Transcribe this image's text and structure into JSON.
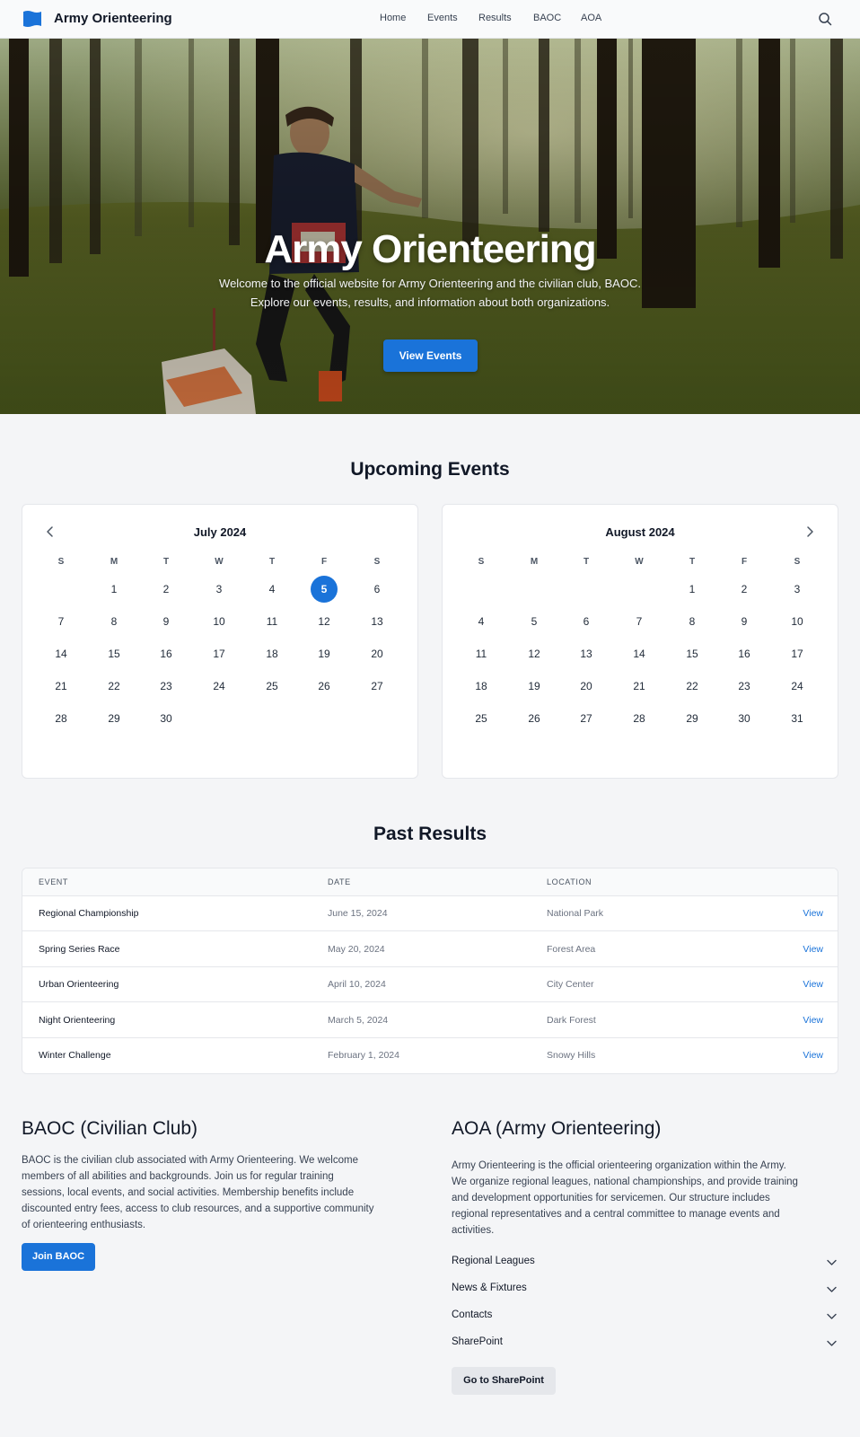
{
  "nav": {
    "brand": "Army Orienteering",
    "links": [
      "Home",
      "Events",
      "Results",
      "BAOC",
      "AOA"
    ],
    "search_icon": "search-icon",
    "logo_icon": "flag-icon",
    "brand_color": "#1a73d9"
  },
  "hero": {
    "title": "Army Orienteering",
    "subtitle_line1": "Welcome to the official website for Army Orienteering and the civilian club, BAOC.",
    "subtitle_line2": "Explore our events, results, and information about both organizations.",
    "button_label": "View Events"
  },
  "events": {
    "title": "Upcoming Events",
    "weekdays": [
      "S",
      "M",
      "T",
      "W",
      "T",
      "F",
      "S"
    ],
    "calendars": [
      {
        "month": "July 2024",
        "first_weekday": 1,
        "days": 30,
        "selected": 5
      },
      {
        "month": "August 2024",
        "first_weekday": 4,
        "days": 31,
        "selected": null
      }
    ],
    "prev_icon": "chevron-left-icon",
    "next_icon": "chevron-right-icon"
  },
  "results": {
    "title": "Past Results",
    "headers": {
      "event": "EVENT",
      "date": "DATE",
      "location": "LOCATION"
    },
    "rows": [
      {
        "event": "Regional Championship",
        "date": "June 15, 2024",
        "location": "National Park",
        "action": "View"
      },
      {
        "event": "Spring Series Race",
        "date": "May 20, 2024",
        "location": "Forest Area",
        "action": "View"
      },
      {
        "event": "Urban Orienteering",
        "date": "April 10, 2024",
        "location": "City Center",
        "action": "View"
      },
      {
        "event": "Night Orienteering",
        "date": "March 5, 2024",
        "location": "Dark Forest",
        "action": "View"
      },
      {
        "event": "Winter Challenge",
        "date": "February 1, 2024",
        "location": "Snowy Hills",
        "action": "View"
      }
    ]
  },
  "baoc": {
    "title": "BAOC (Civilian Club)",
    "lines": [
      "BAOC is the civilian club associated with Army Orienteering. We welcome",
      "members of all abilities and backgrounds. Join us for regular training",
      "sessions, local events, and social activities. Membership benefits include",
      "discounted entry fees, access to club resources, and a supportive community",
      "of orienteering enthusiasts."
    ],
    "button_label": "Join BAOC"
  },
  "aoa": {
    "title": "AOA (Army Orienteering)",
    "lines": [
      "Army Orienteering is the official orienteering organization within the Army.",
      "We organize regional leagues, national championships, and provide training",
      "and development opportunities for servicemen. Our structure includes",
      "regional representatives and a central committee to manage events and",
      "activities."
    ],
    "accordion": [
      "Regional Leagues",
      "News & Fixtures",
      "Contacts",
      "SharePoint"
    ],
    "accordion_icon": "chevron-down-icon",
    "button_label": "Go to SharePoint"
  }
}
